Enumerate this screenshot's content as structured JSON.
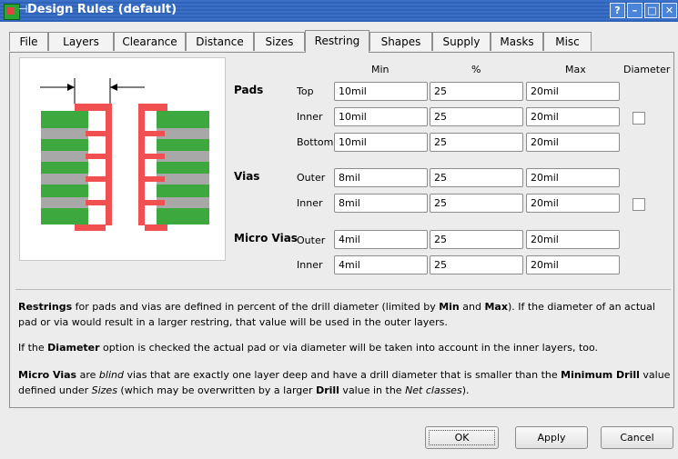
{
  "window": {
    "title": "Design Rules (default)"
  },
  "titlebar_buttons": {
    "help": "?",
    "minimize": "–",
    "maximize": "□",
    "close": "✕"
  },
  "tabs": [
    "File",
    "Layers",
    "Clearance",
    "Distance",
    "Sizes",
    "Restring",
    "Shapes",
    "Supply",
    "Masks",
    "Misc"
  ],
  "active_tab": "Restring",
  "columns": {
    "min": "Min",
    "percent": "%",
    "max": "Max",
    "diameter": "Diameter"
  },
  "groups": {
    "pads": {
      "label": "Pads",
      "rows": [
        {
          "label": "Top",
          "min": "10mil",
          "percent": "25",
          "max": "20mil"
        },
        {
          "label": "Inner",
          "min": "10mil",
          "percent": "25",
          "max": "20mil",
          "diameter_checked": false
        },
        {
          "label": "Bottom",
          "min": "10mil",
          "percent": "25",
          "max": "20mil"
        }
      ]
    },
    "vias": {
      "label": "Vias",
      "rows": [
        {
          "label": "Outer",
          "min": "8mil",
          "percent": "25",
          "max": "20mil"
        },
        {
          "label": "Inner",
          "min": "8mil",
          "percent": "25",
          "max": "20mil",
          "diameter_checked": false
        }
      ]
    },
    "micro_vias": {
      "label": "Micro Vias",
      "rows": [
        {
          "label": "Outer",
          "min": "4mil",
          "percent": "25",
          "max": "20mil"
        },
        {
          "label": "Inner",
          "min": "4mil",
          "percent": "25",
          "max": "20mil"
        }
      ]
    }
  },
  "help": {
    "p1": {
      "b1": "Restrings",
      "t1": " for pads and vias are defined in percent of the drill diameter (limited by ",
      "b2": "Min",
      "t2": " and ",
      "b3": "Max",
      "t3": "). If the diameter of an actual pad or via would result in a larger restring, that value will be used in the outer layers."
    },
    "p2": {
      "t1": "If the ",
      "b1": "Diameter",
      "t2": " option is checked the actual pad or via diameter will be taken into account in the inner layers, too."
    },
    "p3": {
      "b1": "Micro Vias",
      "t1": " are ",
      "i1": "blind",
      "t2": " vias that are exactly one layer deep and have a drill diameter that is smaller than the ",
      "b2": "Minimum Drill",
      "t3": " value defined under ",
      "i2": "Sizes",
      "t4": " (which may be overwritten by a larger ",
      "b3": "Drill",
      "t5": " value in the ",
      "i3": "Net classes",
      "t6": ")."
    }
  },
  "buttons": {
    "ok": "OK",
    "apply": "Apply",
    "cancel": "Cancel"
  },
  "colors": {
    "board_green": "#3da83d",
    "copper_red": "#f05050",
    "drill_gray": "#a8a8a8",
    "title_blue": "#2f63b8"
  }
}
